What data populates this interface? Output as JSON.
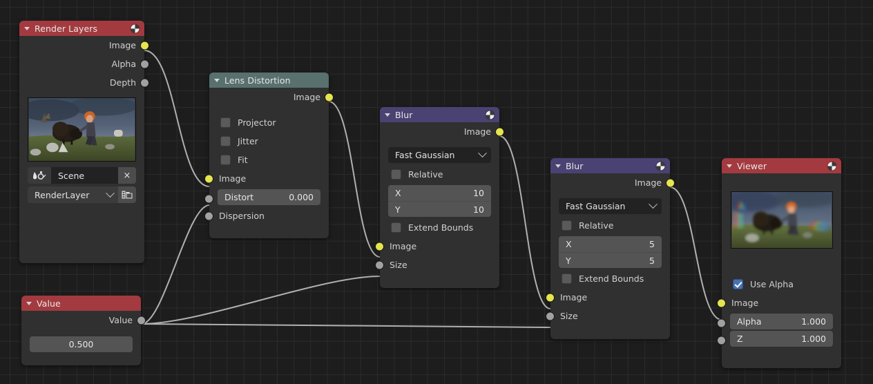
{
  "app": {
    "editor": "Blender Compositor Node Editor"
  },
  "nodes": [
    {
      "key": "render_layers",
      "title": "Render Layers",
      "header_color": "#a33a3f",
      "outputs": [
        {
          "label": "Image",
          "type": "image"
        },
        {
          "label": "Alpha",
          "type": "value"
        },
        {
          "label": "Depth",
          "type": "value"
        }
      ],
      "scene": {
        "value": "Scene",
        "clear_label": "×"
      },
      "layer": {
        "value": "RenderLayer"
      }
    },
    {
      "key": "lens_distortion",
      "title": "Lens Distortion",
      "header_color": "#58706e",
      "outputs": [
        {
          "label": "Image",
          "type": "image"
        }
      ],
      "checkboxes": [
        {
          "label": "Projector",
          "checked": false
        },
        {
          "label": "Jitter",
          "checked": false
        },
        {
          "label": "Fit",
          "checked": false
        }
      ],
      "inputs": [
        {
          "label": "Image",
          "type": "image"
        },
        {
          "label": "Distort",
          "type": "value",
          "value": "0.000"
        },
        {
          "label": "Dispersion",
          "type": "value"
        }
      ]
    },
    {
      "key": "blur_1",
      "title": "Blur",
      "header_color": "#4a4272",
      "outputs": [
        {
          "label": "Image",
          "type": "image"
        }
      ],
      "filter_type": "Fast Gaussian",
      "relative": {
        "label": "Relative",
        "checked": false
      },
      "size_x": {
        "label": "X",
        "value": "10"
      },
      "size_y": {
        "label": "Y",
        "value": "10"
      },
      "extend_bounds": {
        "label": "Extend Bounds",
        "checked": false
      },
      "inputs": [
        {
          "label": "Image",
          "type": "image"
        },
        {
          "label": "Size",
          "type": "value"
        }
      ]
    },
    {
      "key": "blur_2",
      "title": "Blur",
      "header_color": "#4a4272",
      "outputs": [
        {
          "label": "Image",
          "type": "image"
        }
      ],
      "filter_type": "Fast Gaussian",
      "relative": {
        "label": "Relative",
        "checked": false
      },
      "size_x": {
        "label": "X",
        "value": "5"
      },
      "size_y": {
        "label": "Y",
        "value": "5"
      },
      "extend_bounds": {
        "label": "Extend Bounds",
        "checked": false
      },
      "inputs": [
        {
          "label": "Image",
          "type": "image"
        },
        {
          "label": "Size",
          "type": "value"
        }
      ]
    },
    {
      "key": "viewer",
      "title": "Viewer",
      "header_color": "#a33a3f",
      "use_alpha": {
        "label": "Use Alpha",
        "checked": true
      },
      "inputs": [
        {
          "label": "Image",
          "type": "image"
        },
        {
          "label": "Alpha",
          "type": "value",
          "value": "1.000"
        },
        {
          "label": "Z",
          "type": "value",
          "value": "1.000"
        }
      ]
    },
    {
      "key": "value",
      "title": "Value",
      "header_color": "#a33a3f",
      "outputs": [
        {
          "label": "Value",
          "type": "value"
        }
      ],
      "value_field": "0.500"
    }
  ],
  "icons": {
    "node_preview": "sphere-quadrant-icon",
    "collapse": "triangle-down-icon",
    "dropdown": "chevron-down-icon",
    "scene_browse": "scene-browse-icon",
    "render_layer_browse": "render-layer-browse-icon"
  },
  "link_color": "#b0b0b0"
}
